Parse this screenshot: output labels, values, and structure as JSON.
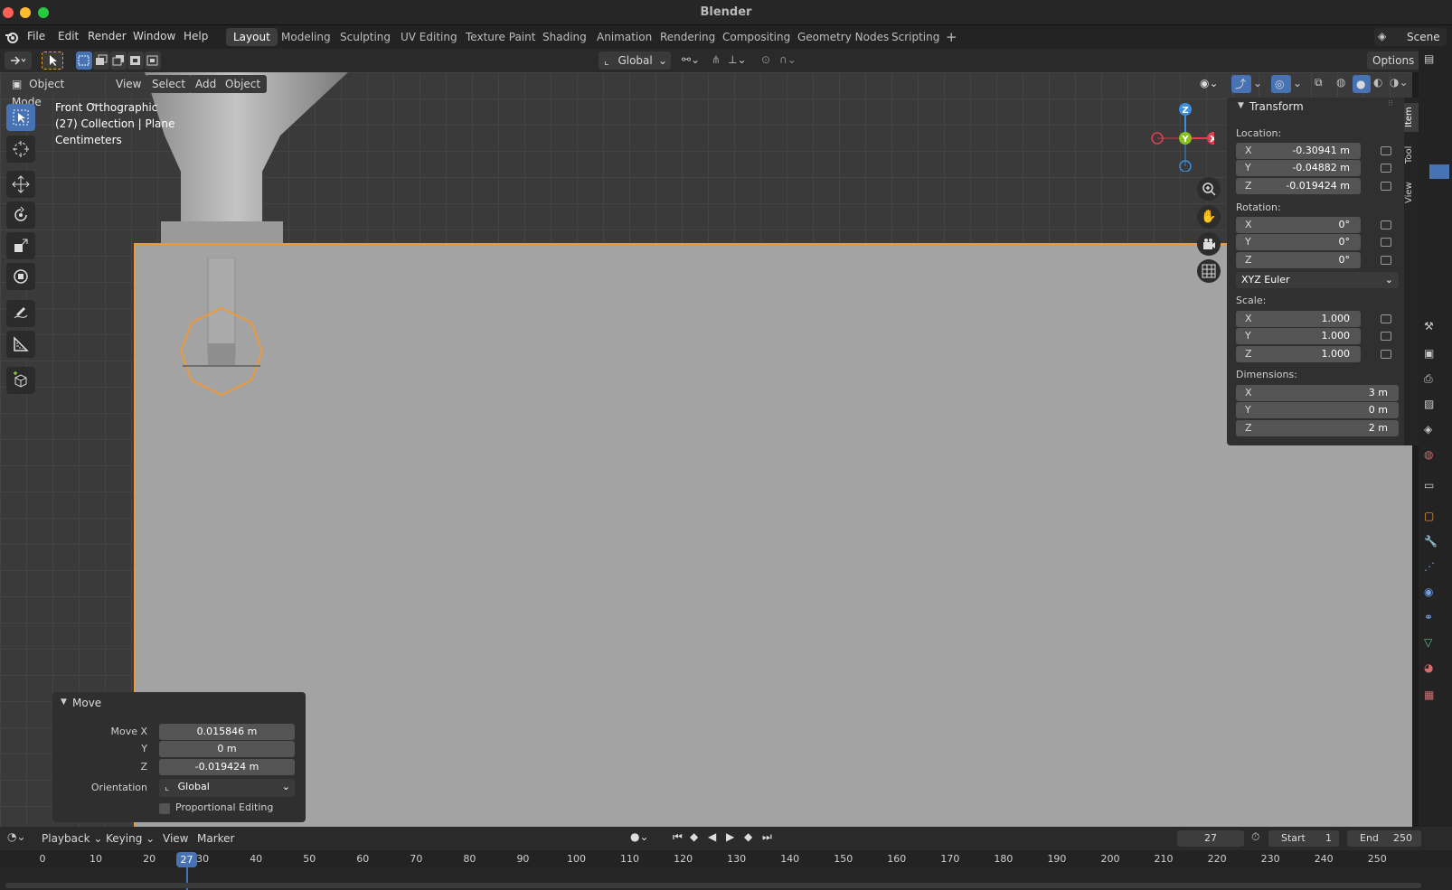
{
  "window": {
    "title": "Blender"
  },
  "menu": {
    "items": [
      "File",
      "Edit",
      "Render",
      "Window",
      "Help"
    ]
  },
  "workspaces": [
    "Layout",
    "Modeling",
    "Sculpting",
    "UV Editing",
    "Texture Paint",
    "Shading",
    "Animation",
    "Rendering",
    "Compositing",
    "Geometry Nodes",
    "Scripting"
  ],
  "active_workspace": "Layout",
  "scene_name": "Scene",
  "toolheader": {
    "orientation": "Global",
    "options_label": "Options"
  },
  "viewport": {
    "mode": "Object Mode",
    "menus": [
      "View",
      "Select",
      "Add",
      "Object"
    ],
    "info_view": "Front Orthographic",
    "info_collection": "(27) Collection | Plane",
    "info_units": "Centimeters",
    "gizmo_axes": {
      "x": "X",
      "y": "Y",
      "z": "Z"
    }
  },
  "npanel": {
    "section": "Transform",
    "location_label": "Location:",
    "location": [
      {
        "axis": "X",
        "value": "-0.30941 m"
      },
      {
        "axis": "Y",
        "value": "-0.04882 m"
      },
      {
        "axis": "Z",
        "value": "-0.019424 m"
      }
    ],
    "rotation_label": "Rotation:",
    "rotation": [
      {
        "axis": "X",
        "value": "0°"
      },
      {
        "axis": "Y",
        "value": "0°"
      },
      {
        "axis": "Z",
        "value": "0°"
      }
    ],
    "rotation_mode": "XYZ Euler",
    "scale_label": "Scale:",
    "scale": [
      {
        "axis": "X",
        "value": "1.000"
      },
      {
        "axis": "Y",
        "value": "1.000"
      },
      {
        "axis": "Z",
        "value": "1.000"
      }
    ],
    "dimensions_label": "Dimensions:",
    "dimensions": [
      {
        "axis": "X",
        "value": "3 m"
      },
      {
        "axis": "Y",
        "value": "0 m"
      },
      {
        "axis": "Z",
        "value": "2 m"
      }
    ],
    "tabs": [
      "Item",
      "Tool",
      "View"
    ]
  },
  "operator": {
    "title": "Move",
    "move_x_label": "Move X",
    "move_x": "0.015846 m",
    "y_label": "Y",
    "y": "0 m",
    "z_label": "Z",
    "z": "-0.019424 m",
    "orientation_label": "Orientation",
    "orientation": "Global",
    "proportional_label": "Proportional Editing"
  },
  "timeline": {
    "menus": [
      "Playback",
      "Keying",
      "View",
      "Marker"
    ],
    "current_frame": "27",
    "start_label": "Start",
    "start": "1",
    "end_label": "End",
    "end": "250",
    "ticks": [
      "0",
      "10",
      "20",
      "30",
      "40",
      "50",
      "60",
      "70",
      "80",
      "90",
      "100",
      "110",
      "120",
      "130",
      "140",
      "150",
      "160",
      "170",
      "180",
      "190",
      "200",
      "210",
      "220",
      "230",
      "240",
      "250"
    ]
  },
  "colors": {
    "accent": "#4772b3",
    "selection": "#e99a3d",
    "axis_x": "#e0404f",
    "axis_y": "#86c11f",
    "axis_z": "#3b8ee0"
  }
}
